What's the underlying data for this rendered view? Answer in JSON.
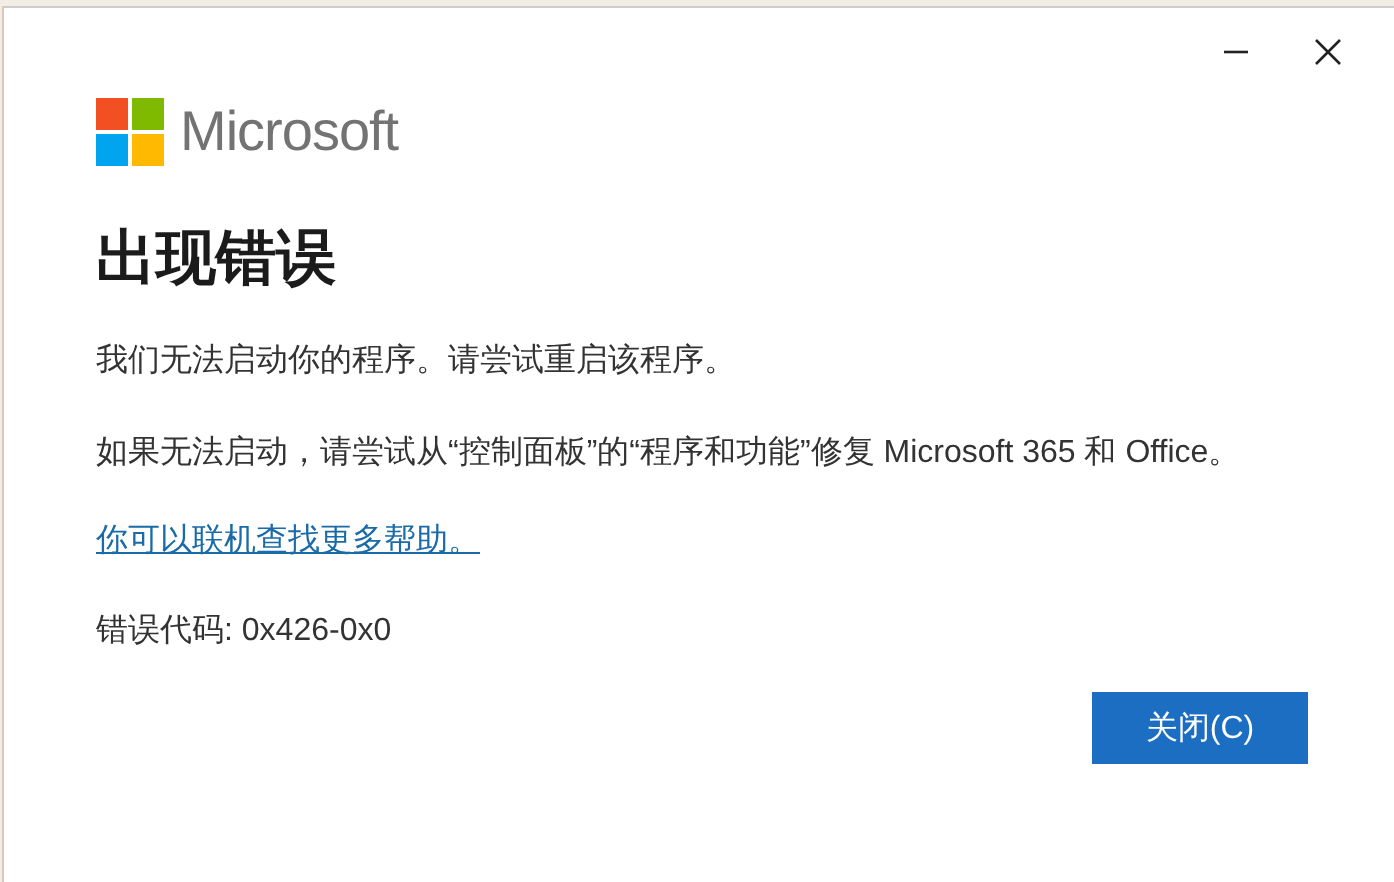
{
  "brand": {
    "name": "Microsoft"
  },
  "title": "出现错误",
  "paragraphs": [
    "我们无法启动你的程序。请尝试重启该程序。",
    "如果无法启动，请尝试从“控制面板”的“程序和功能”修复 Microsoft 365 和 Office。"
  ],
  "help_link": "你可以联机查找更多帮助。",
  "error_code": "错误代码: 0x426-0x0",
  "buttons": [
    {
      "label": "关闭(C)",
      "kind": "primary"
    }
  ]
}
